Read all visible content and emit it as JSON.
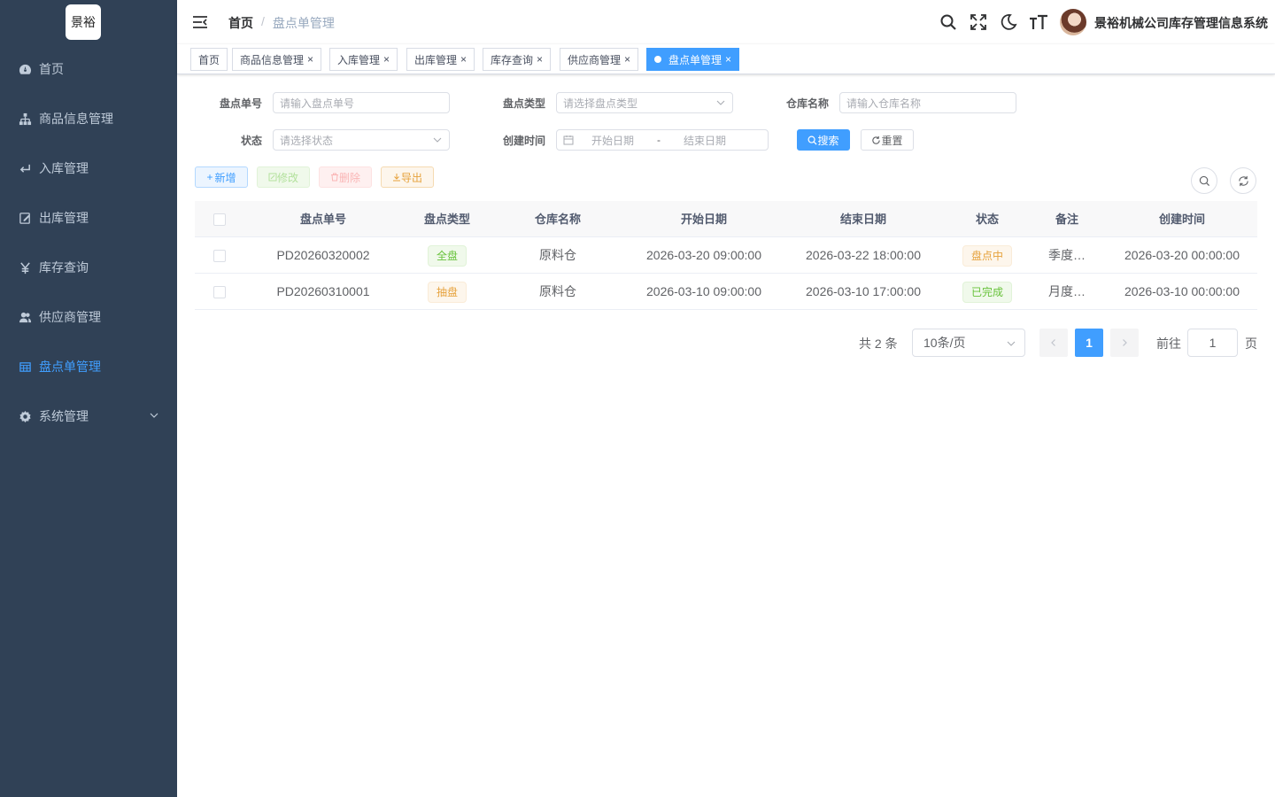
{
  "logo_text": "景裕",
  "sidebar": {
    "items": [
      {
        "label": "首页",
        "icon": "dashboard-icon"
      },
      {
        "label": "商品信息管理",
        "icon": "tree-icon"
      },
      {
        "label": "入库管理",
        "icon": "enter-icon"
      },
      {
        "label": "出库管理",
        "icon": "edit-icon"
      },
      {
        "label": "库存查询",
        "icon": "yen-icon"
      },
      {
        "label": "供应商管理",
        "icon": "peoples-icon"
      },
      {
        "label": "盘点单管理",
        "icon": "table-icon"
      },
      {
        "label": "系统管理",
        "icon": "system-icon"
      }
    ]
  },
  "navbar": {
    "breadcrumb_home": "首页",
    "breadcrumb_sep": "/",
    "breadcrumb_current": "盘点单管理",
    "system_name": "景裕机械公司库存管理信息系统"
  },
  "tags": [
    {
      "label": "首页",
      "closable": false
    },
    {
      "label": "商品信息管理",
      "closable": true
    },
    {
      "label": "入库管理",
      "closable": true
    },
    {
      "label": "出库管理",
      "closable": true
    },
    {
      "label": "库存查询",
      "closable": true
    },
    {
      "label": "供应商管理",
      "closable": true
    },
    {
      "label": "盘点单管理",
      "closable": true,
      "active": true
    }
  ],
  "close_glyph": "×",
  "search": {
    "check_no_label": "盘点单号",
    "check_no_placeholder": "请输入盘点单号",
    "check_type_label": "盘点类型",
    "check_type_placeholder": "请选择盘点类型",
    "warehouse_label": "仓库名称",
    "warehouse_placeholder": "请输入仓库名称",
    "status_label": "状态",
    "status_placeholder": "请选择状态",
    "created_label": "创建时间",
    "start_placeholder": "开始日期",
    "range_sep": "-",
    "end_placeholder": "结束日期",
    "search_btn": "搜索",
    "reset_btn": "重置"
  },
  "toolbar": {
    "add": "新增",
    "edit": "修改",
    "delete": "删除",
    "export": "导出"
  },
  "table": {
    "headers": [
      "盘点单号",
      "盘点类型",
      "仓库名称",
      "开始日期",
      "结束日期",
      "状态",
      "备注",
      "创建时间"
    ],
    "rows": [
      {
        "check_no": "PD20260320002",
        "type": "全盘",
        "type_color": "success",
        "warehouse": "原料仓",
        "start": "2026-03-20 09:00:00",
        "end": "2026-03-22 18:00:00",
        "status": "盘点中",
        "status_color": "warning",
        "remark": "季度…",
        "created": "2026-03-20 00:00:00"
      },
      {
        "check_no": "PD20260310001",
        "type": "抽盘",
        "type_color": "warning",
        "warehouse": "原料仓",
        "start": "2026-03-10 09:00:00",
        "end": "2026-03-10 17:00:00",
        "status": "已完成",
        "status_color": "success",
        "remark": "月度…",
        "created": "2026-03-10 00:00:00"
      }
    ]
  },
  "pagination": {
    "total_text": "共 2 条",
    "page_size": "10条/页",
    "current_page": "1",
    "goto_prefix": "前往",
    "goto_value": "1",
    "goto_suffix": "页"
  },
  "colors": {
    "sidebar_bg": "#304156",
    "accent": "#409eff",
    "success": "#67c23a",
    "warning": "#e6a23c"
  }
}
